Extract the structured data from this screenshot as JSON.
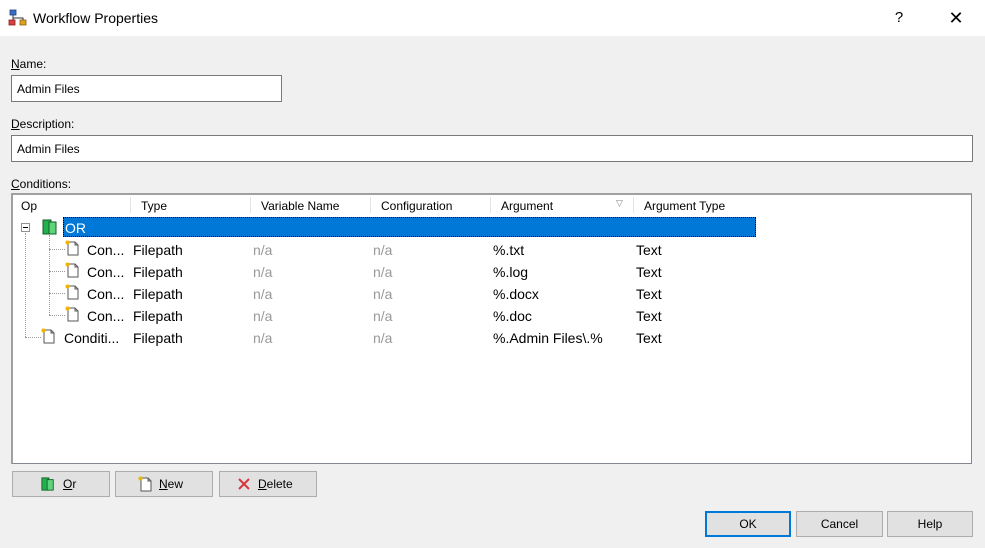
{
  "window": {
    "title": "Workflow Properties",
    "help_label": "?",
    "close_label": "✕"
  },
  "name": {
    "label_underline": "N",
    "label_rest": "ame:",
    "value": "Admin Files"
  },
  "description": {
    "label_underline": "D",
    "label_rest": "escription:",
    "value": "Admin Files"
  },
  "conditions": {
    "label_underline": "C",
    "label_rest": "onditions:",
    "columns": [
      "Op",
      "Type",
      "Variable Name",
      "Configuration",
      "Argument",
      "Argument Type"
    ],
    "root": {
      "op": "OR"
    },
    "rows": [
      {
        "op": "Con...",
        "type": "Filepath",
        "variable_name": "n/a",
        "configuration": "n/a",
        "argument": "%.txt",
        "argument_type": "Text"
      },
      {
        "op": "Con...",
        "type": "Filepath",
        "variable_name": "n/a",
        "configuration": "n/a",
        "argument": "%.log",
        "argument_type": "Text"
      },
      {
        "op": "Con...",
        "type": "Filepath",
        "variable_name": "n/a",
        "configuration": "n/a",
        "argument": "%.docx",
        "argument_type": "Text"
      },
      {
        "op": "Con...",
        "type": "Filepath",
        "variable_name": "n/a",
        "configuration": "n/a",
        "argument": "%.doc",
        "argument_type": "Text"
      },
      {
        "op": "Conditi...",
        "type": "Filepath",
        "variable_name": "n/a",
        "configuration": "n/a",
        "argument": "%.Admin Files\\.%",
        "argument_type": "Text"
      }
    ]
  },
  "buttons": {
    "or": {
      "underline": "O",
      "rest": "r"
    },
    "new": {
      "underline": "N",
      "rest": "ew"
    },
    "delete": {
      "underline": "D",
      "rest": "elete"
    },
    "ok": "OK",
    "cancel": "Cancel",
    "help": "Help"
  },
  "colors": {
    "selection": "#0078d7",
    "dialog_bg": "#f0f0f0",
    "or_icon_green": "#22b14c",
    "delete_x_red": "#d9363e"
  },
  "icons": {
    "title": "workflow-icon",
    "or": "or-gate-icon",
    "condition": "new-document-icon",
    "delete": "delete-x-icon"
  }
}
